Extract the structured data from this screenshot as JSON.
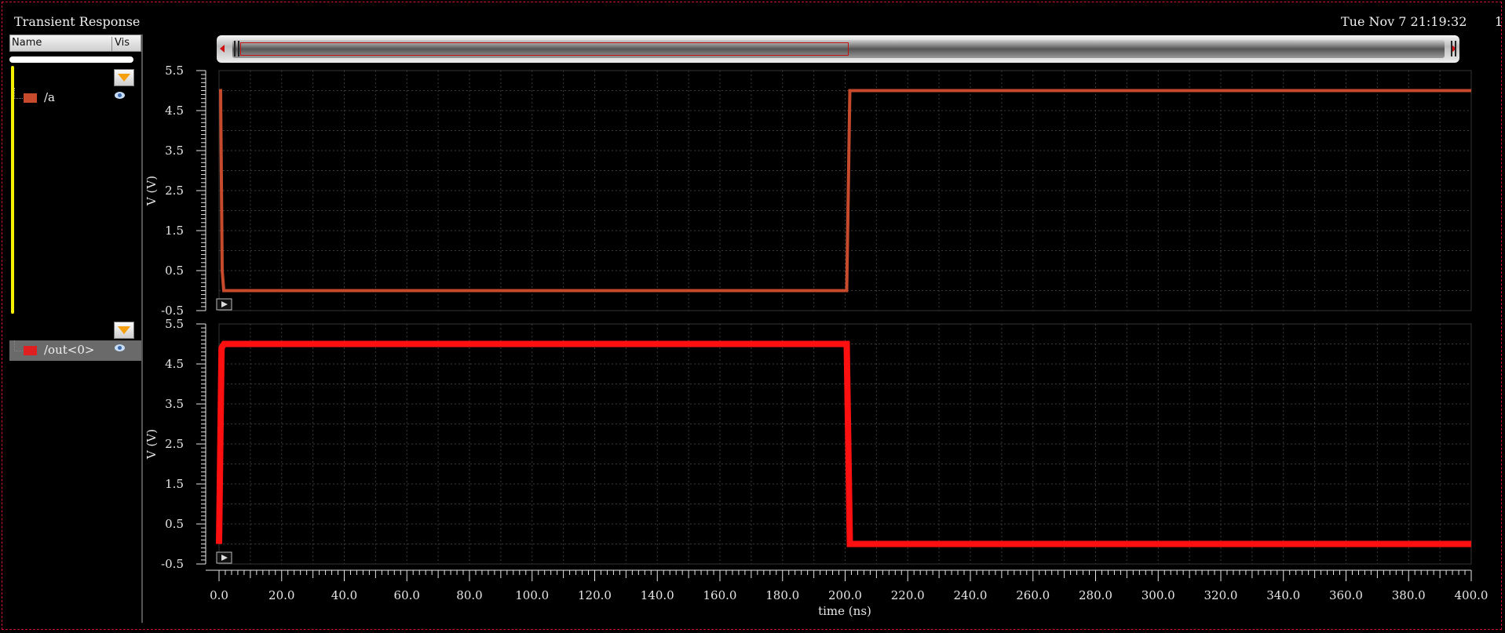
{
  "window": {
    "title": "Transient Response",
    "datetime": "Tue Nov 7 21:19:32",
    "corner_char": "1"
  },
  "signal_panel": {
    "columns": {
      "name": "Name",
      "vis": "Vis"
    },
    "strips": [
      {
        "signal": "/a",
        "color": "#c84a2c",
        "selected": false
      },
      {
        "signal": "/out<0>",
        "color": "#e02020",
        "selected": true
      }
    ]
  },
  "icons": [
    "filter-icon",
    "eye-icon",
    "play-icon"
  ],
  "chart_data": [
    {
      "type": "line",
      "title": "",
      "xlabel": "",
      "ylabel": "V (V)",
      "xlim": [
        0,
        400
      ],
      "ylim": [
        -0.5,
        5.5
      ],
      "yticks": [
        "5.5",
        "4.5",
        "3.5",
        "2.5",
        "1.5",
        "0.5",
        "-0.5"
      ],
      "grid": true,
      "series": [
        {
          "name": "/a",
          "color": "#c84a2c",
          "x": [
            0,
            0.5,
            1.0,
            1.5,
            200.0,
            200.5,
            201.5,
            400
          ],
          "y": [
            5.0,
            5.0,
            0.5,
            0.0,
            0.0,
            0.0,
            5.0,
            5.0
          ]
        }
      ]
    },
    {
      "type": "line",
      "title": "",
      "xlabel": "time (ns)",
      "ylabel": "V (V)",
      "xlim": [
        0,
        400
      ],
      "ylim": [
        -0.5,
        5.5
      ],
      "yticks": [
        "5.5",
        "4.5",
        "3.5",
        "2.5",
        "1.5",
        "0.5",
        "-0.5"
      ],
      "xticks": [
        "0.0",
        "20.0",
        "40.0",
        "60.0",
        "80.0",
        "100.0",
        "120.0",
        "140.0",
        "160.0",
        "180.0",
        "200.0",
        "220.0",
        "240.0",
        "260.0",
        "280.0",
        "300.0",
        "320.0",
        "340.0",
        "360.0",
        "380.0",
        "400.0"
      ],
      "grid": true,
      "series": [
        {
          "name": "/out<0>",
          "color": "#ff1010",
          "x": [
            0,
            0.8,
            1.6,
            200.0,
            200.5,
            201.5,
            400
          ],
          "y": [
            0.0,
            4.9,
            5.0,
            5.0,
            5.0,
            0.0,
            0.0
          ]
        }
      ]
    }
  ]
}
